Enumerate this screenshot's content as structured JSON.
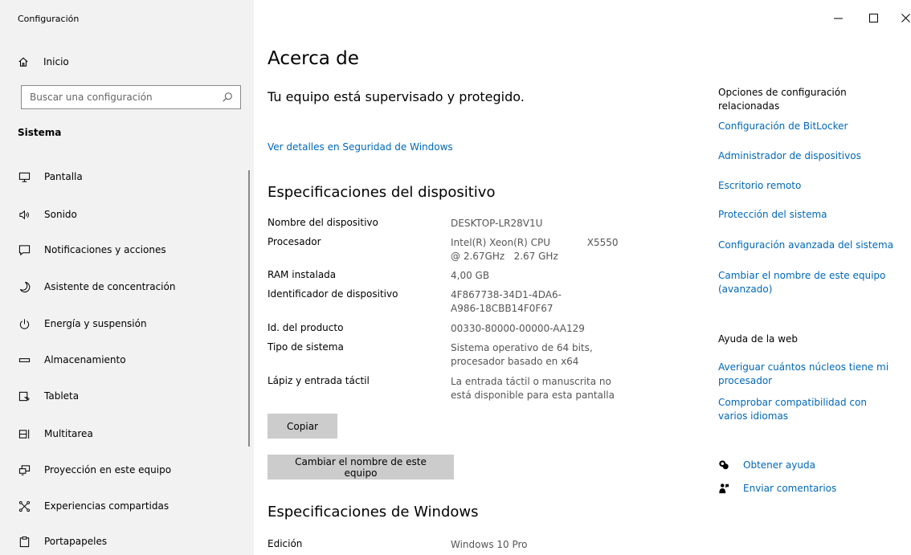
{
  "window": {
    "title": "Configuración",
    "controls": [
      "minimize-icon",
      "maximize-icon",
      "close-icon"
    ]
  },
  "sidebar": {
    "home_label": "Inicio",
    "search_placeholder": "Buscar una configuración",
    "section_title": "Sistema",
    "items": [
      {
        "label": "Pantalla",
        "icon": "monitor-icon"
      },
      {
        "label": "Sonido",
        "icon": "speaker-icon"
      },
      {
        "label": "Notificaciones y acciones",
        "icon": "notification-icon"
      },
      {
        "label": "Asistente de concentración",
        "icon": "moon-icon"
      },
      {
        "label": "Energía y suspensión",
        "icon": "power-icon"
      },
      {
        "label": "Almacenamiento",
        "icon": "storage-icon"
      },
      {
        "label": "Tableta",
        "icon": "tablet-icon"
      },
      {
        "label": "Multitarea",
        "icon": "multitask-icon"
      },
      {
        "label": "Proyección en este equipo",
        "icon": "projection-icon"
      },
      {
        "label": "Experiencias compartidas",
        "icon": "shared-icon"
      },
      {
        "label": "Portapapeles",
        "icon": "clipboard-icon"
      }
    ]
  },
  "main": {
    "title": "Acerca de",
    "status": "Tu equipo está supervisado y protegido.",
    "security_link": "Ver detalles en Seguridad de Windows",
    "device_specs": {
      "heading": "Especificaciones del dispositivo",
      "rows": [
        {
          "label": "Nombre del dispositivo",
          "value": "DESKTOP-LR28V1U"
        },
        {
          "label": "Procesador",
          "value": "Intel(R) Xeon(R) CPU            X5550\n@ 2.67GHz   2.67 GHz"
        },
        {
          "label": "RAM instalada",
          "value": "4,00 GB"
        },
        {
          "label": "Identificador de dispositivo",
          "value": "4F867738-34D1-4DA6-\nA986-18CBB14F0F67"
        },
        {
          "label": "Id. del producto",
          "value": "00330-80000-00000-AA129"
        },
        {
          "label": "Tipo de sistema",
          "value": "Sistema operativo de 64 bits,\nprocesador basado en x64"
        },
        {
          "label": "Lápiz y entrada táctil",
          "value": "La entrada táctil o manuscrita no\nestá disponible para esta pantalla"
        }
      ],
      "copy_button": "Copiar",
      "rename_button": "Cambiar el nombre de este equipo"
    },
    "windows_specs": {
      "heading": "Especificaciones de Windows",
      "rows": [
        {
          "label": "Edición",
          "value": "Windows 10 Pro"
        }
      ]
    }
  },
  "related": {
    "title": "Opciones de configuración relacionadas",
    "links": [
      "Configuración de BitLocker",
      "Administrador de dispositivos",
      "Escritorio remoto",
      "Protección del sistema",
      "Configuración avanzada del sistema",
      "Cambiar el nombre de este equipo (avanzado)"
    ],
    "help_title": "Ayuda de la web",
    "help_links": [
      "Averiguar cuántos núcleos tiene mi procesador",
      "Comprobar compatibilidad con varios idiomas"
    ],
    "get_help": "Obtener ayuda",
    "feedback": "Enviar comentarios"
  },
  "colors": {
    "link": "#0067b8",
    "sidebar_bg": "#f2f2f2",
    "button_bg": "#cccccc"
  }
}
